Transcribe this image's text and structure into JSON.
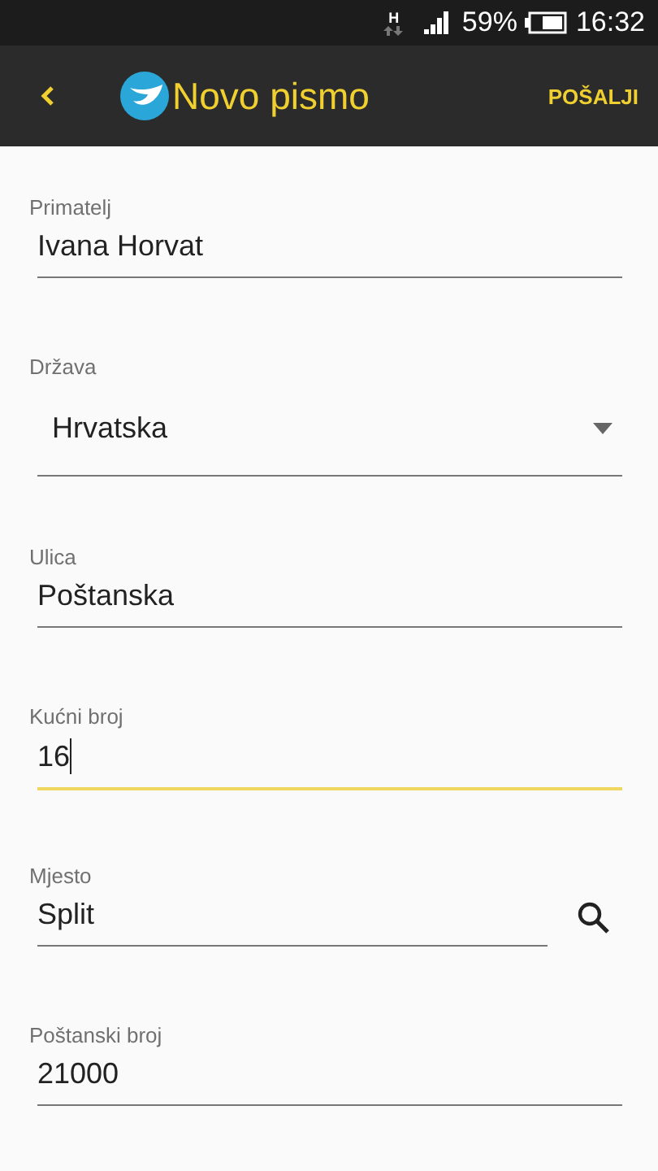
{
  "status_bar": {
    "network": "H",
    "battery": "59%",
    "time": "16:32"
  },
  "app_bar": {
    "title": "Novo pismo",
    "action": "POŠALJI"
  },
  "fields": [
    {
      "kind": "text",
      "label": "Primatelj",
      "value": "Ivana Horvat",
      "focused": false
    },
    {
      "kind": "dropdown",
      "label": "Država",
      "value": "Hrvatska",
      "focused": false
    },
    {
      "kind": "text",
      "label": "Ulica",
      "value": "Poštanska",
      "focused": false
    },
    {
      "kind": "text",
      "label": "Kućni broj",
      "value": "16",
      "focused": true
    },
    {
      "kind": "search",
      "label": "Mjesto",
      "value": "Split",
      "focused": false
    },
    {
      "kind": "text",
      "label": "Poštanski broj",
      "value": "21000",
      "focused": false
    }
  ]
}
